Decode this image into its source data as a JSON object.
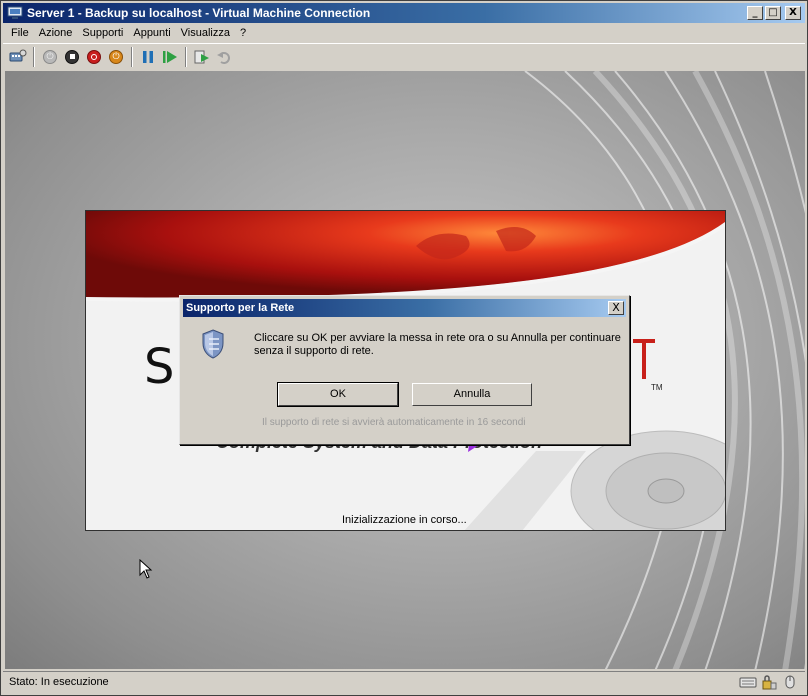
{
  "window": {
    "title": "Server 1 - Backup su localhost - Virtual Machine Connection",
    "icon": "vm-connection-icon",
    "controls": [
      "_",
      "□",
      "X"
    ]
  },
  "menu": {
    "items": [
      "File",
      "Azione",
      "Supporti",
      "Appunti",
      "Visualizza",
      "?"
    ]
  },
  "toolbar": {
    "buttons": [
      {
        "name": "ctrl-alt-del-icon"
      },
      {
        "name": "start-icon"
      },
      {
        "name": "turn-off-icon"
      },
      {
        "name": "shutdown-icon"
      },
      {
        "name": "save-state-icon"
      },
      {
        "name": "pause-icon"
      },
      {
        "name": "resume-icon"
      },
      {
        "name": "snapshot-icon"
      },
      {
        "name": "revert-icon"
      }
    ],
    "colors": {
      "pause": "#1f6fb5",
      "resume": "#2ea043",
      "shutdown": "#c81e1e",
      "save": "#d8871a"
    }
  },
  "splash": {
    "logo_letter": "S",
    "tm": "TM",
    "tagline": "Complete System and Data Protection",
    "status": "Inizializzazione in corso..."
  },
  "dialog": {
    "title": "Supporto per la Rete",
    "message": "Cliccare su OK per avviare la messa in rete ora o su Annulla per continuare senza il supporto di rete.",
    "ok_label": "OK",
    "cancel_label": "Annulla",
    "note": "Il supporto di rete si avvierà automaticamente in 16 secondi",
    "close": "X"
  },
  "annotation": {
    "arrow_color": "#9b30e0"
  },
  "statusbar": {
    "text": "Stato: In esecuzione"
  }
}
